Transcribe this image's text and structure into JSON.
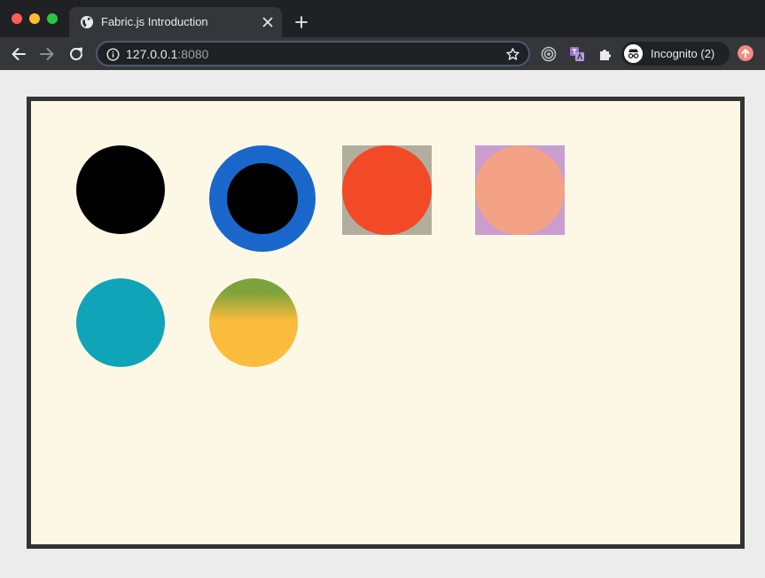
{
  "browser": {
    "tab": {
      "title": "Fabric.js Introduction",
      "favicon": "globe-icon"
    },
    "address": {
      "host": "127.0.0.1",
      "port": ":8080"
    },
    "profile": {
      "label": "Incognito (2)",
      "icon": "incognito-icon"
    },
    "icons": {
      "back": "arrow-left-icon",
      "forward": "arrow-right-icon",
      "reload": "reload-icon",
      "info": "info-icon",
      "bookmark": "star-icon",
      "extension_1": "target-icon",
      "extension_2": "translate-icon",
      "extension_3": "puzzle-icon",
      "update": "update-icon"
    },
    "colors": {
      "tabbar": "#202124",
      "toolbar": "#35363a",
      "update": "#f28b82"
    }
  },
  "canvas": {
    "background": "#fdf8e6",
    "border": "#333333",
    "shapes": [
      {
        "name": "black-circle",
        "fill": "#000000"
      },
      {
        "name": "blue-ring-circle",
        "fill": "#000000",
        "stroke": "#1a67cc"
      },
      {
        "name": "red-circle-box",
        "fill": "#f24a27",
        "background": "#b2ae9f"
      },
      {
        "name": "salmon-circle-box",
        "fill": "#f4a286",
        "background": "#cb9dcf"
      },
      {
        "name": "teal-circle",
        "fill": "#0fa4b8"
      },
      {
        "name": "gradient-circle",
        "gradient": [
          "#7da33c",
          "#fbbb3d"
        ]
      }
    ]
  }
}
